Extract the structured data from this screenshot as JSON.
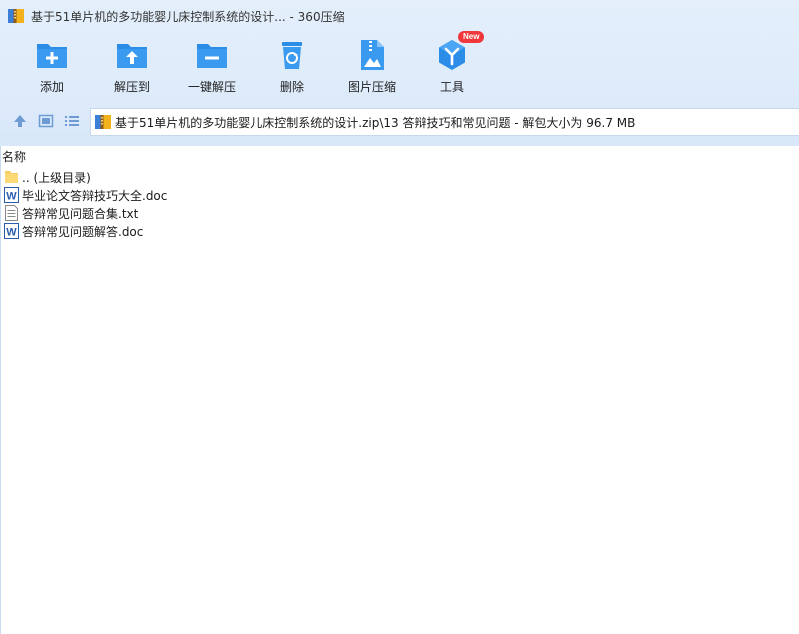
{
  "window": {
    "title": "基于51单片机的多功能婴儿床控制系统的设计... - 360压缩"
  },
  "toolbar": {
    "add_label": "添加",
    "extract_to_label": "解压到",
    "one_click_extract_label": "一键解压",
    "delete_label": "删除",
    "image_compress_label": "图片压缩",
    "tools_label": "工具",
    "tools_badge": "New"
  },
  "nav": {
    "path": "基于51单片机的多功能婴儿床控制系统的设计.zip\\13 答辩技巧和常见问题 - 解包大小为 96.7 MB"
  },
  "list": {
    "column_name": "名称",
    "items": [
      {
        "name": ".. (上级目录)",
        "icon": "folder-icon"
      },
      {
        "name": "毕业论文答辩技巧大全.doc",
        "icon": "word-doc-icon"
      },
      {
        "name": "答辩常见问题合集.txt",
        "icon": "text-file-icon"
      },
      {
        "name": "答辩常见问题解答.doc",
        "icon": "word-doc-icon"
      }
    ]
  },
  "colors": {
    "accent": "#2b8de8",
    "toolbar_bg": "#deebfa",
    "badge": "#f0383c"
  }
}
